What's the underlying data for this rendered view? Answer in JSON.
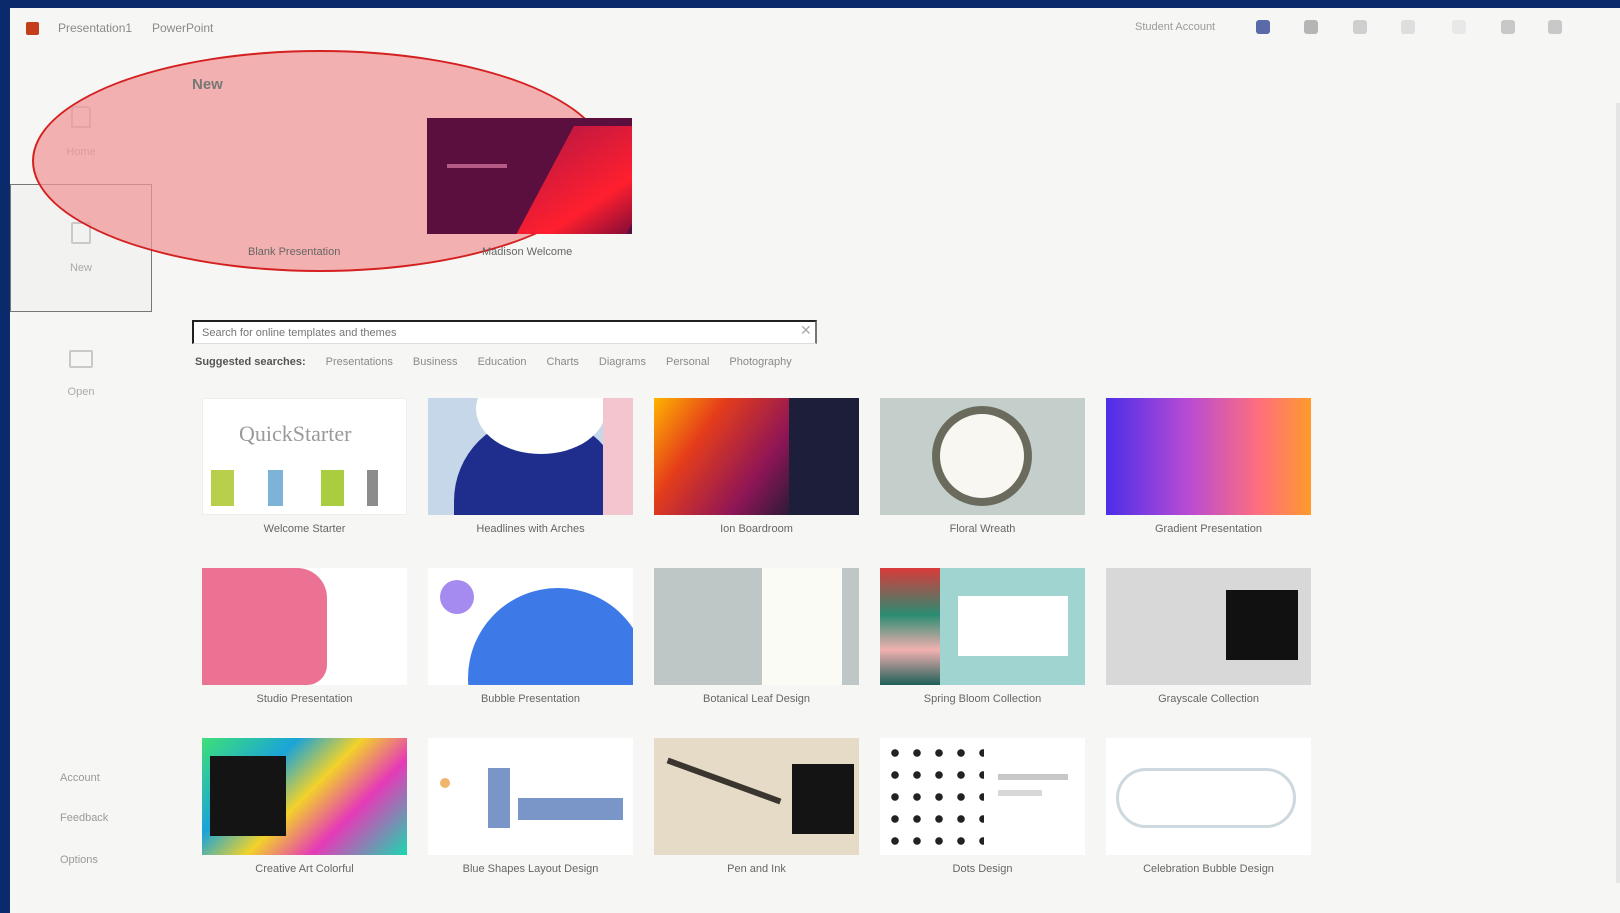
{
  "titlebar": {
    "document_title": "Presentation1",
    "app_name": "PowerPoint",
    "user_name": "Student Account"
  },
  "nav": {
    "items": [
      {
        "label": "Home",
        "icon": "home-icon"
      },
      {
        "label": "New",
        "icon": "new-file-icon"
      },
      {
        "label": "Open",
        "icon": "open-folder-icon"
      }
    ],
    "bottom": [
      "Account",
      "Feedback",
      "Options"
    ]
  },
  "new_section": {
    "title": "New",
    "cards": [
      {
        "label": "Blank Presentation"
      },
      {
        "label": "Madison Welcome"
      }
    ]
  },
  "search": {
    "placeholder": "Search for online templates and themes",
    "clear_icon": "close-icon"
  },
  "tabs": [
    "Suggested searches:",
    "Presentations",
    "Business",
    "Education",
    "Charts",
    "Diagrams",
    "Personal",
    "Photography"
  ],
  "templates": [
    {
      "label": "Welcome Starter"
    },
    {
      "label": "Headlines with Arches"
    },
    {
      "label": "Ion Boardroom"
    },
    {
      "label": "Floral Wreath"
    },
    {
      "label": "Gradient Presentation"
    },
    {
      "label": "Studio Presentation"
    },
    {
      "label": "Bubble Presentation"
    },
    {
      "label": "Botanical Leaf Design"
    },
    {
      "label": "Spring Bloom Collection"
    },
    {
      "label": "Grayscale Collection"
    },
    {
      "label": "Creative Art Colorful"
    },
    {
      "label": "Blue Shapes Layout Design"
    },
    {
      "label": "Pen and Ink"
    },
    {
      "label": "Dots Design"
    },
    {
      "label": "Celebration Bubble Design"
    }
  ],
  "quickstarter_thumb_text": "QuickStarter",
  "highlight_color": "#d42020"
}
